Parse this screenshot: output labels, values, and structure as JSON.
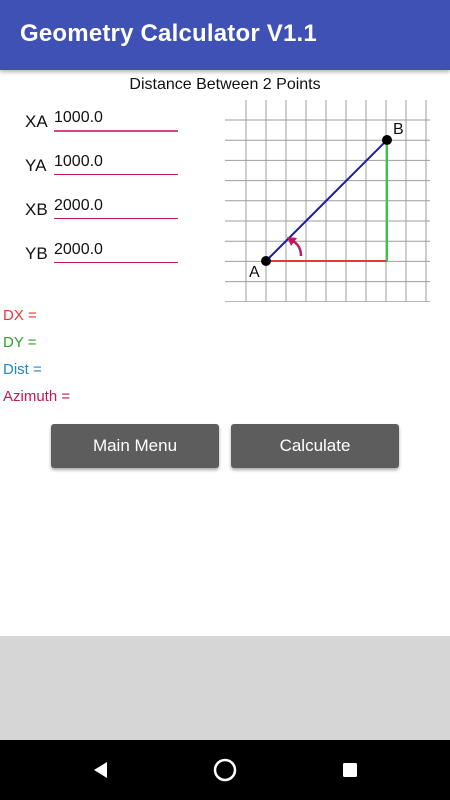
{
  "app_bar": {
    "title": "Geometry Calculator V1.1"
  },
  "subtitle": "Distance Between 2 Points",
  "fields": [
    {
      "label": "XA",
      "value": "1000.0"
    },
    {
      "label": "YA",
      "value": "1000.0"
    },
    {
      "label": "XB",
      "value": "2000.0"
    },
    {
      "label": "YB",
      "value": "2000.0"
    }
  ],
  "diagram": {
    "point_a_label": "A",
    "point_b_label": "B",
    "colors": {
      "grid": "#9e9e9e",
      "hypotenuse": "#1a1aa6",
      "dx_line": "#e53935",
      "dy_line": "#2ecc40",
      "angle_arrow": "#c2185b"
    }
  },
  "results": {
    "dx": {
      "label": "DX =",
      "color": "#e53935"
    },
    "dy": {
      "label": "DY =",
      "color": "#2e9e2e"
    },
    "dist": {
      "label": "Dist =",
      "color": "#1e88c8"
    },
    "azimuth": {
      "label": "Azimuth =",
      "color": "#c2185b"
    }
  },
  "buttons": {
    "main_menu": "Main Menu",
    "calculate": "Calculate"
  },
  "nav": {
    "back_icon": "back-triangle-icon",
    "home_icon": "home-circle-icon",
    "recents_icon": "recents-square-icon"
  }
}
